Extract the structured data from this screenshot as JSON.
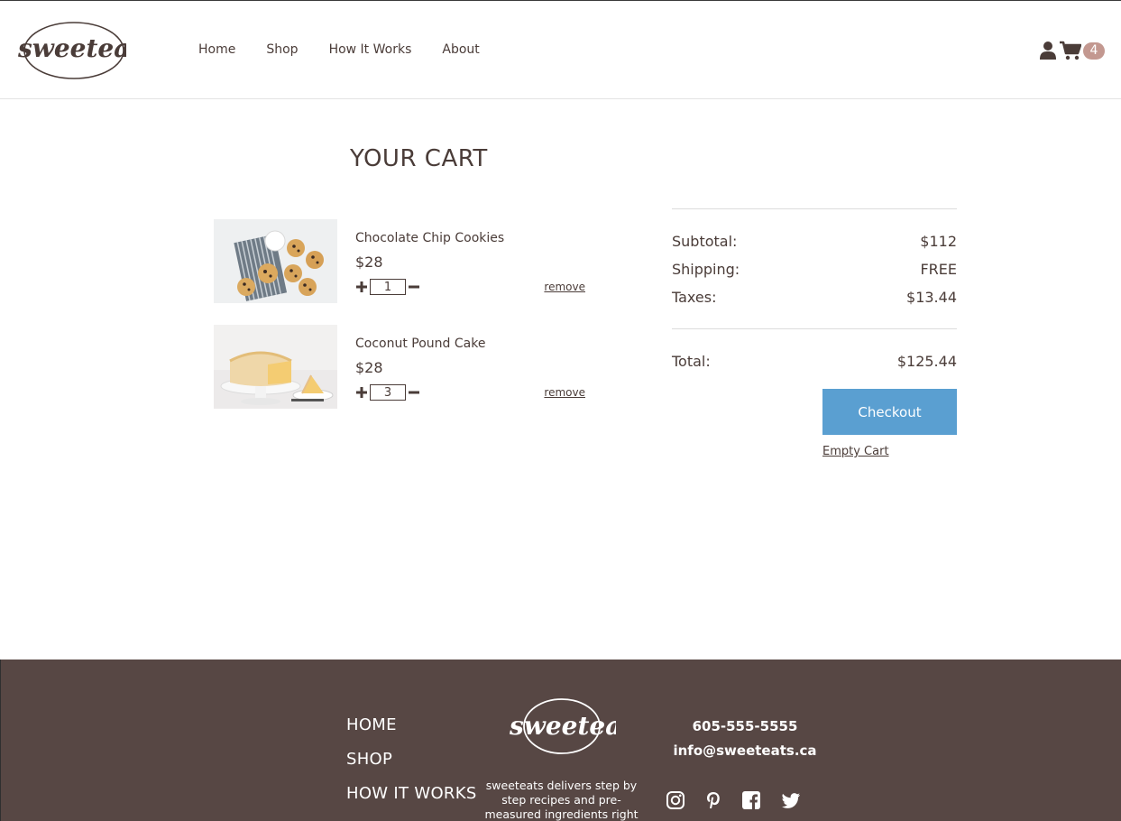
{
  "brand": {
    "name": "sweeteats"
  },
  "nav": {
    "items": [
      {
        "label": "Home"
      },
      {
        "label": "Shop"
      },
      {
        "label": "How It Works"
      },
      {
        "label": "About"
      }
    ]
  },
  "header": {
    "cart_count": "4",
    "user_icon": "user-icon",
    "cart_icon": "shopping-cart-icon"
  },
  "cart": {
    "title": "YOUR CART",
    "items": [
      {
        "name": "Chocolate Chip Cookies",
        "price": "$28",
        "quantity": "1",
        "remove_label": "remove",
        "image": "cookies-photo"
      },
      {
        "name": "Coconut Pound Cake",
        "price": "$28",
        "quantity": "3",
        "remove_label": "remove",
        "image": "pound-cake-photo"
      }
    ]
  },
  "summary": {
    "subtotal_label": "Subtotal:",
    "subtotal_value": "$112",
    "shipping_label": "Shipping:",
    "shipping_value": "FREE",
    "taxes_label": "Taxes:",
    "taxes_value": "$13.44",
    "total_label": "Total:",
    "total_value": "$125.44",
    "checkout_label": "Checkout",
    "empty_cart_label": "Empty Cart"
  },
  "footer": {
    "links": [
      {
        "label": "HOME"
      },
      {
        "label": "SHOP"
      },
      {
        "label": "HOW IT WORKS"
      }
    ],
    "description": "sweeteats delivers step by step recipes and pre-measured ingredients right",
    "phone": "605-555-5555",
    "email": "info@sweeteats.ca",
    "social": [
      "instagram-icon",
      "pinterest-icon",
      "facebook-icon",
      "twitter-icon"
    ]
  },
  "colors": {
    "brand_brown": "#574744",
    "text": "#4a3c38",
    "checkout_blue": "#5a9fd1",
    "badge": "#c39890"
  }
}
